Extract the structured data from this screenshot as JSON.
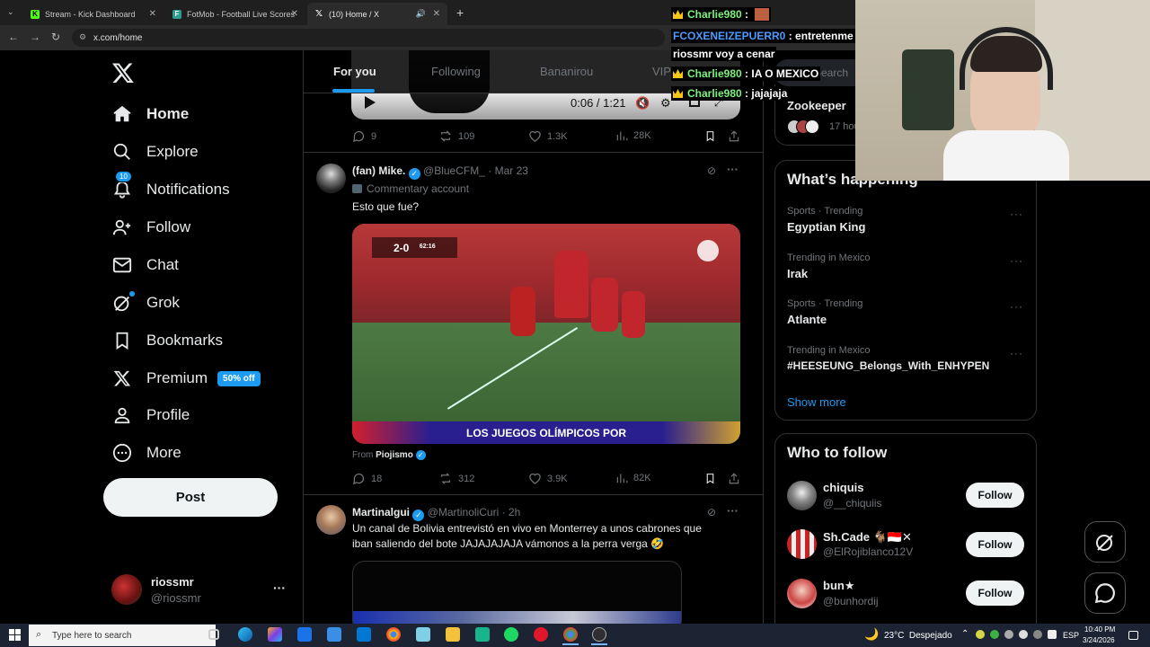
{
  "browser": {
    "tabs": [
      {
        "label": "Stream - Kick Dashboard",
        "favicon": "K",
        "color": "#53fc18"
      },
      {
        "label": "FotMob - Football Live Scores",
        "favicon": "F",
        "color": "#2a9d8f"
      },
      {
        "label": "(10) Home / X",
        "favicon": "X",
        "color": "#ffffff"
      }
    ],
    "new_tab": "+",
    "url": "x.com/home"
  },
  "nav": {
    "items": [
      {
        "label": "Home",
        "icon": "home-icon"
      },
      {
        "label": "Explore",
        "icon": "search-icon"
      },
      {
        "label": "Notifications",
        "icon": "bell-icon",
        "badge": "10"
      },
      {
        "label": "Follow",
        "icon": "person-plus-icon"
      },
      {
        "label": "Chat",
        "icon": "envelope-icon"
      },
      {
        "label": "Grok",
        "icon": "grok-icon"
      },
      {
        "label": "Bookmarks",
        "icon": "bookmark-icon"
      },
      {
        "label": "Premium",
        "icon": "x-logo-icon",
        "badge": "50% off"
      },
      {
        "label": "Profile",
        "icon": "person-icon"
      },
      {
        "label": "More",
        "icon": "more-circle-icon"
      }
    ],
    "post": "Post",
    "account": {
      "name": "riossmr",
      "handle": "@riossmr",
      "menu": "···"
    }
  },
  "feed": {
    "tabs": [
      "For you",
      "Following",
      "Bananirou",
      "VIP"
    ],
    "video_top": {
      "time": "0:06 / 1:21"
    },
    "post0_stats": {
      "replies": "9",
      "reposts": "109",
      "likes": "1.3K",
      "views": "28K"
    },
    "post1": {
      "name": "(fan) Mike.",
      "handle": "@BlueCFM_",
      "time": "· Mar 23",
      "affiliation": "Commentary account",
      "text": "Esto que fue?",
      "scorebug": {
        "teams": "2-0",
        "clock": "62:16",
        "banner": "LOS JUEGOS OLÍMPICOS POR"
      },
      "from_label": "From",
      "from_name": "Piojismo",
      "stats": {
        "replies": "18",
        "reposts": "312",
        "likes": "3.9K",
        "views": "82K"
      }
    },
    "post2": {
      "name": "Martinalgui",
      "handle": "@MartinoliCuri",
      "time": "· 2h",
      "text_line1": "Un canal de Bolivia entrevistó en vivo en Monterrey a unos cabrones que",
      "text_line2": "iban saliendo del bote JAJAJAJAJA vámonos a la perra verga 🤣"
    }
  },
  "right": {
    "search_placeholder": "Search",
    "top_card": {
      "title": "Zookeeper",
      "time": "17 hou"
    },
    "happening": {
      "title": "What’s happening",
      "trends": [
        {
          "category": "Sports · Trending",
          "name": "Egyptian King"
        },
        {
          "category": "Trending in Mexico",
          "name": "Irak"
        },
        {
          "category": "Sports · Trending",
          "name": "Atlante"
        },
        {
          "category": "Trending in Mexico",
          "name": "#HEESEUNG_Belongs_With_ENHYPEN"
        }
      ],
      "show_more": "Show more"
    },
    "who_to_follow": {
      "title": "Who to follow",
      "users": [
        {
          "name": "chiquis",
          "handle": "@__chiquiis",
          "button": "Follow"
        },
        {
          "name": "Sh.Cade 🐐🇮🇩✕",
          "handle": "@ElRojiblanco12V",
          "button": "Follow"
        },
        {
          "name": "bun★",
          "handle": "@bunhordij",
          "button": "Follow"
        }
      ]
    }
  },
  "chat_overlay": [
    {
      "user": "Charlie980",
      "msg": "",
      "crown": true
    },
    {
      "user": "FCOXENEIZEPUERR0",
      "msg": "entretenme",
      "crown": false
    },
    {
      "user": "riossmr",
      "msg": "voy a cenar",
      "crown": false
    },
    {
      "user": "Charlie980",
      "msg": "IA O MEXICO",
      "crown": true
    },
    {
      "user": "Charlie980",
      "msg": "jajajaja",
      "crown": true
    }
  ],
  "taskbar": {
    "search_placeholder": "Type here to search",
    "weather": "23°C  Despejado",
    "lang": "ESP",
    "time": "10:40 PM",
    "date": "3/24/2026"
  }
}
